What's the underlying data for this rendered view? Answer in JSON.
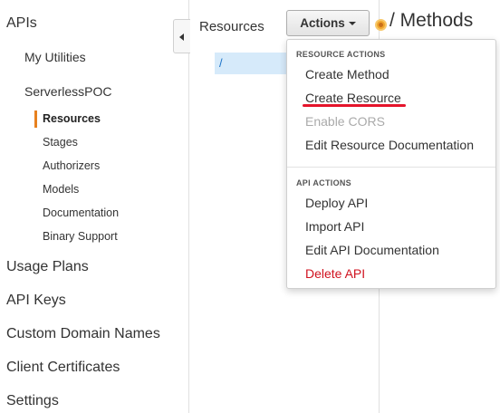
{
  "sidebar": {
    "items": [
      {
        "label": "APIs"
      },
      {
        "label": "My Utilities"
      },
      {
        "label": "ServerlessPOC"
      },
      {
        "label": "Resources"
      },
      {
        "label": "Stages"
      },
      {
        "label": "Authorizers"
      },
      {
        "label": "Models"
      },
      {
        "label": "Documentation"
      },
      {
        "label": "Binary Support"
      },
      {
        "label": "Usage Plans"
      },
      {
        "label": "API Keys"
      },
      {
        "label": "Custom Domain Names"
      },
      {
        "label": "Client Certificates"
      },
      {
        "label": "Settings"
      }
    ],
    "active_item": "Resources",
    "active_color": "#e7811f"
  },
  "resources": {
    "title": "Resources",
    "root_path": "/"
  },
  "toolbar": {
    "actions_label": "Actions"
  },
  "methods": {
    "title": "/ Methods"
  },
  "dropdown": {
    "resource_header": "RESOURCE ACTIONS",
    "resource_items": [
      {
        "label": "Create Method"
      },
      {
        "label": "Create Resource"
      },
      {
        "label": "Enable CORS"
      },
      {
        "label": "Edit Resource Documentation"
      }
    ],
    "api_header": "API ACTIONS",
    "api_items": [
      {
        "label": "Deploy API"
      },
      {
        "label": "Import API"
      },
      {
        "label": "Edit API Documentation"
      },
      {
        "label": "Delete API"
      }
    ],
    "danger_color": "#d0121f",
    "highlight_color": "#e5142b"
  },
  "colors": {
    "selected_row_bg": "#d6eafa",
    "link": "#1a73c8",
    "status_dot": "#f0a52c"
  }
}
